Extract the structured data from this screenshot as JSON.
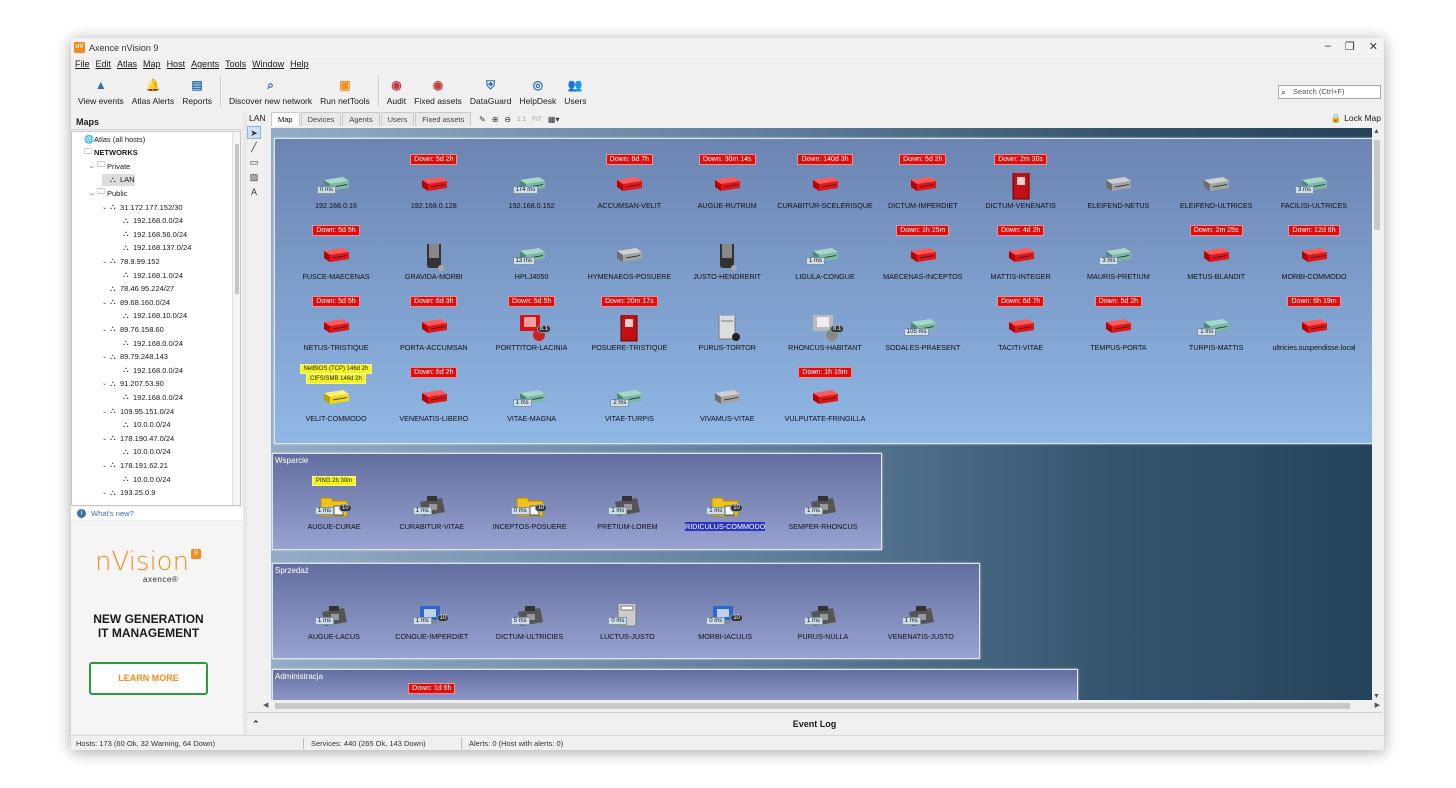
{
  "window": {
    "title": "Axence nVision 9",
    "app_icon": "nV",
    "minimize": "–",
    "restore": "❐",
    "close": "✕"
  },
  "menu": [
    "File",
    "Edit",
    "Atlas",
    "Map",
    "Host",
    "Agents",
    "Tools",
    "Window",
    "Help"
  ],
  "toolbar": [
    {
      "label": "View events",
      "icon": "warning-icon",
      "glyph": "▲",
      "color": "#2c6fb5"
    },
    {
      "label": "Atlas Alerts",
      "icon": "bell-icon",
      "glyph": "🔔",
      "color": "#2c6fb5"
    },
    {
      "label": "Reports",
      "icon": "report-icon",
      "glyph": "▤",
      "color": "#2c6fb5"
    },
    {
      "label": "Discover new network",
      "icon": "discover-icon",
      "glyph": "⌕",
      "color": "#2c6fb5"
    },
    {
      "label": "Run netTools",
      "icon": "nettools-icon",
      "glyph": "▣",
      "color": "#f28c1a"
    },
    {
      "label": "Audit",
      "icon": "audit-icon",
      "glyph": "◉",
      "color": "#c63b3b"
    },
    {
      "label": "Fixed assets",
      "icon": "fixed-assets-icon",
      "glyph": "◉",
      "color": "#c63b3b"
    },
    {
      "label": "DataGuard",
      "icon": "shield-icon",
      "glyph": "⛨",
      "color": "#2c6fb5"
    },
    {
      "label": "HelpDesk",
      "icon": "helpdesk-icon",
      "glyph": "◎",
      "color": "#2c6fb5"
    },
    {
      "label": "Users",
      "icon": "users-icon",
      "glyph": "👥",
      "color": "#2c6fb5"
    }
  ],
  "search": {
    "placeholder": "Search (Ctrl+F)"
  },
  "left_panel": {
    "title": "Maps",
    "tree": [
      {
        "label": "Atlas (all hosts)",
        "level": 0,
        "icon": "globe-icon",
        "tw": ""
      },
      {
        "label": "NETWORKS",
        "level": 0,
        "icon": "folder-icon",
        "tw": ""
      },
      {
        "label": "Private",
        "level": 1,
        "icon": "folder-icon",
        "tw": "⌄"
      },
      {
        "label": "LAN",
        "level": 2,
        "icon": "network-icon",
        "tw": "",
        "selected": true
      },
      {
        "label": "Public",
        "level": 1,
        "icon": "folder-icon",
        "tw": "⌄"
      },
      {
        "label": "31.172.177.152/30",
        "level": 2,
        "icon": "network-icon",
        "tw": "⌄"
      },
      {
        "label": "192.168.0.0/24",
        "level": 3,
        "icon": "network-icon",
        "tw": ""
      },
      {
        "label": "192.168.56.0/24",
        "level": 3,
        "icon": "network-icon",
        "tw": ""
      },
      {
        "label": "192.168.137.0/24",
        "level": 3,
        "icon": "network-icon",
        "tw": ""
      },
      {
        "label": "78.9.99.152",
        "level": 2,
        "icon": "network-icon",
        "tw": "⌄"
      },
      {
        "label": "192.168.1.0/24",
        "level": 3,
        "icon": "network-icon",
        "tw": ""
      },
      {
        "label": "78.46.95.224/27",
        "level": 2,
        "icon": "network-icon",
        "tw": ""
      },
      {
        "label": "89.68.160.0/24",
        "level": 2,
        "icon": "network-icon",
        "tw": "⌄"
      },
      {
        "label": "192.168.10.0/24",
        "level": 3,
        "icon": "network-icon",
        "tw": ""
      },
      {
        "label": "89.76.158.60",
        "level": 2,
        "icon": "network-icon",
        "tw": "⌄"
      },
      {
        "label": "192.168.0.0/24",
        "level": 3,
        "icon": "network-icon",
        "tw": ""
      },
      {
        "label": "89.79.248.143",
        "level": 2,
        "icon": "network-icon",
        "tw": "⌄"
      },
      {
        "label": "192.168.0.0/24",
        "level": 3,
        "icon": "network-icon",
        "tw": ""
      },
      {
        "label": "91.207.53.90",
        "level": 2,
        "icon": "network-icon",
        "tw": "⌄"
      },
      {
        "label": "192.168.0.0/24",
        "level": 3,
        "icon": "network-icon",
        "tw": ""
      },
      {
        "label": "109.95.151.0/24",
        "level": 2,
        "icon": "network-icon",
        "tw": "⌄"
      },
      {
        "label": "10.0.0.0/24",
        "level": 3,
        "icon": "network-icon",
        "tw": ""
      },
      {
        "label": "178.190.47.0/24",
        "level": 2,
        "icon": "network-icon",
        "tw": "⌄"
      },
      {
        "label": "10.0.0.0/24",
        "level": 3,
        "icon": "network-icon",
        "tw": ""
      },
      {
        "label": "178.191.62.21",
        "level": 2,
        "icon": "network-icon",
        "tw": "⌄"
      },
      {
        "label": "10.0.0.0/24",
        "level": 3,
        "icon": "network-icon",
        "tw": ""
      },
      {
        "label": "193.25.0.9",
        "level": 2,
        "icon": "network-icon",
        "tw": "⌄"
      }
    ],
    "whats_new": "What's new?"
  },
  "ad": {
    "logo": "nVision",
    "logo_badge": "9",
    "logo_sub": "axence®",
    "headline1": "NEW GENERATION",
    "headline2": "IT MANAGEMENT",
    "button": "LEARN MORE"
  },
  "map": {
    "breadcrumb": "LAN",
    "tabs": [
      "Map",
      "Devices",
      "Agents",
      "Users",
      "Fixed assets"
    ],
    "tools": {
      "fit": "FIT",
      "one": "1:1"
    },
    "lock": "Lock Map",
    "main_hosts": [
      {
        "name": "192.168.0.16",
        "type": "switch-ok",
        "ms": "0 ms"
      },
      {
        "name": "192.168.0.128",
        "type": "switch-down",
        "down": "Down: 5d 2h"
      },
      {
        "name": "192.168.0.152",
        "type": "switch-ok",
        "ms": "174 ms"
      },
      {
        "name": "ACCUMSAN-VELIT",
        "type": "switch-down",
        "down": "Down: 6d 7h"
      },
      {
        "name": "AUGUE-RUTRUM",
        "type": "switch-down",
        "down": "Down: 30m 14s"
      },
      {
        "name": "CURABITUR-SCELERISQUE",
        "type": "switch-down",
        "down": "Down: 140d 3h"
      },
      {
        "name": "DICTUM-IMPERDIET",
        "type": "switch-down",
        "down": "Down: 5d 2h"
      },
      {
        "name": "DICTUM-VENENATIS",
        "type": "tower-down",
        "down": "Down: 2m 30s"
      },
      {
        "name": "ELEIFEND-NETUS",
        "type": "switch-gray"
      },
      {
        "name": "ELEIFEND-ULTRICES",
        "type": "switch-gray"
      },
      {
        "name": "FACILISI-ULTRICES",
        "type": "switch-ok",
        "ms": "3 ms"
      },
      {
        "name": "FUSCE-MAECENAS",
        "type": "switch-down",
        "down": "Down: 5d 5h"
      },
      {
        "name": "GRAVIDA-MORBI",
        "type": "phone"
      },
      {
        "name": "HPLJ4050",
        "type": "switch-ok",
        "ms": "13 ms"
      },
      {
        "name": "HYMENAEOS-POSUERE",
        "type": "switch-gray"
      },
      {
        "name": "JUSTO-HENDRERIT",
        "type": "phone"
      },
      {
        "name": "LIGULA-CONGUE",
        "type": "switch-ok",
        "ms": "1 ms"
      },
      {
        "name": "MAECENAS-INCEPTOS",
        "type": "switch-down",
        "down": "Down: 1h 25m"
      },
      {
        "name": "MATTIS-INTEGER",
        "type": "switch-down",
        "down": "Down: 4d 2h"
      },
      {
        "name": "MAURIS-PRETIUM",
        "type": "switch-ok",
        "ms": "3 ms"
      },
      {
        "name": "METUS-BLANDIT",
        "type": "switch-down",
        "down": "Down: 2m 25s"
      },
      {
        "name": "MORBI-COMMODO",
        "type": "switch-down",
        "down": "Down: 12d 6h"
      },
      {
        "name": "NETUS-TRISTIQUE",
        "type": "switch-down",
        "down": "Down: 5d 5h"
      },
      {
        "name": "PORTA-ACCUMSAN",
        "type": "switch-down",
        "down": "Down: 6d 3h"
      },
      {
        "name": "PORTTITOR-LACINIA",
        "type": "win-down",
        "down": "Down: 5d 5h",
        "badge": "8.1"
      },
      {
        "name": "POSUERE-TRISTIQUE",
        "type": "tower-down",
        "down": "Down: 20m 17s"
      },
      {
        "name": "PURUS-TORTOR",
        "type": "server"
      },
      {
        "name": "RHONCUS-HABITANT",
        "type": "win-gray",
        "badge": "8.1"
      },
      {
        "name": "SODALES-PRAESENT",
        "type": "switch-ok",
        "ms": "105 ms"
      },
      {
        "name": "TACITI-VITAE",
        "type": "switch-down",
        "down": "Down: 6d 7h"
      },
      {
        "name": "TEMPUS-PORTA",
        "type": "switch-down",
        "down": "Down: 5d 2h"
      },
      {
        "name": "TURPIS-MATTIS",
        "type": "switch-ok",
        "ms": "1 ms"
      },
      {
        "name": "ultricies.suspendisse.local",
        "type": "switch-down",
        "down": "Down: 6h 19m"
      },
      {
        "name": "VELIT-COMMODO",
        "type": "switch-yellow",
        "warn1": "NetBIOS (TCP) 146d 2h",
        "warn2": "CIFS/SMB 146d 2h"
      },
      {
        "name": "VENENATIS-LIBERO",
        "type": "switch-down",
        "down": "Down: 6d 2h"
      },
      {
        "name": "VITAE-MAGNA",
        "type": "switch-ok",
        "ms": "1 ms"
      },
      {
        "name": "VITAE-TURPIS",
        "type": "switch-ok",
        "ms": "2 ms"
      },
      {
        "name": "VIVAMUS-VITAE",
        "type": "switch-gray"
      },
      {
        "name": "VULPUTATE-FRINGILLA",
        "type": "switch-down",
        "down": "Down: 1h 16m"
      }
    ],
    "groups": [
      {
        "title": "Wsparcie",
        "hosts": [
          {
            "name": "AUGUE-CURAE",
            "type": "folder",
            "ms": "1 ms",
            "badge": "10",
            "warn1": "PING 2h 30m"
          },
          {
            "name": "CURABITUR-VITAE",
            "type": "phone-desk",
            "ms": "1 ms"
          },
          {
            "name": "INCEPTOS-POSUERE",
            "type": "folder",
            "ms": "0 ms",
            "badge": "10"
          },
          {
            "name": "PRETIUM-LOREM",
            "type": "phone-desk",
            "ms": "1 ms"
          },
          {
            "name": "RIDICULUS-COMMODO",
            "type": "folder",
            "ms": "1 ms",
            "badge": "10",
            "selected": true
          },
          {
            "name": "SEMPER-RHONCUS",
            "type": "phone-desk",
            "ms": "1 ms"
          }
        ]
      },
      {
        "title": "Sprzedaż",
        "hosts": [
          {
            "name": "AUGUE-LACUS",
            "type": "phone-desk",
            "ms": "1 ms"
          },
          {
            "name": "CONGUE-IMPERDIET",
            "type": "win",
            "ms": "1 ms",
            "badge": "10"
          },
          {
            "name": "DICTUM-ULTRICIES",
            "type": "phone-desk",
            "ms": "5 ms"
          },
          {
            "name": "LUCTUS-JUSTO",
            "type": "printer",
            "ms": "0 ms"
          },
          {
            "name": "MORBI-IACULIS",
            "type": "win",
            "ms": "0 ms",
            "badge": "10"
          },
          {
            "name": "PURUS-NULLA",
            "type": "phone-desk",
            "ms": "1 ms"
          },
          {
            "name": "VENENATIS-JUSTO",
            "type": "phone-desk",
            "ms": "1 ms"
          }
        ]
      },
      {
        "title": "Administracja",
        "hosts": [
          {
            "name": "",
            "type": "partial"
          },
          {
            "name": "",
            "type": "partial",
            "down": "Down: 1d 6h"
          }
        ]
      }
    ]
  },
  "event_log": {
    "title": "Event Log",
    "caret": "⌃"
  },
  "status": {
    "hosts": "Hosts: 173 (60 Ok, 32 Warning, 64 Down)",
    "services": "Services: 440 (265 Ok, 143 Down)",
    "alerts": "Alerts: 0 (Host with alerts: 0)"
  },
  "colors": {
    "down": "#e10d0d",
    "ok": "#4fa08c",
    "accent": "#f28c1a"
  }
}
